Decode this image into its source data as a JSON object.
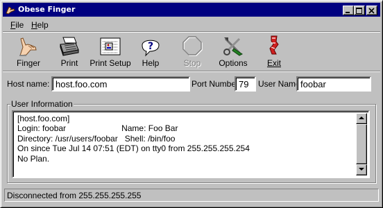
{
  "window": {
    "title": "Obese Finger"
  },
  "menu": [
    {
      "label": "File",
      "key": "F",
      "rest": "ile"
    },
    {
      "label": "Help",
      "key": "H",
      "rest": "elp"
    }
  ],
  "toolbar": [
    {
      "label": "Finger",
      "icon": "finger-icon",
      "enabled": true
    },
    {
      "label": "Print",
      "icon": "printer-icon",
      "enabled": true
    },
    {
      "label": "Print Setup",
      "icon": "print-setup-icon",
      "enabled": true
    },
    {
      "label": "Help",
      "icon": "help-icon",
      "enabled": true
    },
    {
      "label": "Stop",
      "icon": "stop-icon",
      "enabled": false
    },
    {
      "label": "Options",
      "icon": "options-icon",
      "enabled": true
    },
    {
      "label": "Exit",
      "icon": "exit-icon",
      "enabled": true
    }
  ],
  "fields": {
    "host_label": "Host name:",
    "host_value": "host.foo.com",
    "port_label": "Port Number:",
    "port_value": "79",
    "user_label": "User Name:",
    "user_value": "foobar"
  },
  "user_info": {
    "legend": "User Information",
    "lines": [
      "[host.foo.com]",
      "Login: foobar                        Name: Foo Bar",
      "Directory: /usr/users/foobar   Shell: /bin/foo",
      "On since Tue Jul 14 07:51 (EDT) on tty0 from 255.255.255.254",
      "No Plan."
    ]
  },
  "status": {
    "text": "Disconnected from 255.255.255.255"
  },
  "colors": {
    "titlebar": "#000080",
    "face": "#c0c0c0"
  }
}
